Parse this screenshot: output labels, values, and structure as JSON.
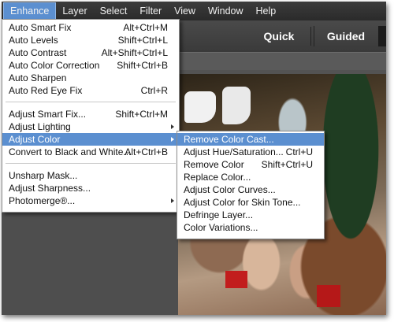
{
  "menubar": {
    "items": [
      "Enhance",
      "Layer",
      "Select",
      "Filter",
      "View",
      "Window",
      "Help"
    ]
  },
  "modes": {
    "quick": "Quick",
    "guided": "Guided"
  },
  "enhance_menu": {
    "items": [
      {
        "label": "Auto Smart Fix",
        "shortcut": "Alt+Ctrl+M"
      },
      {
        "label": "Auto Levels",
        "shortcut": "Shift+Ctrl+L"
      },
      {
        "label": "Auto Contrast",
        "shortcut": "Alt+Shift+Ctrl+L"
      },
      {
        "label": "Auto Color Correction",
        "shortcut": "Shift+Ctrl+B"
      },
      {
        "label": "Auto Sharpen",
        "shortcut": ""
      },
      {
        "label": "Auto Red Eye Fix",
        "shortcut": "Ctrl+R"
      },
      {
        "label": "Adjust Smart Fix...",
        "shortcut": "Shift+Ctrl+M"
      },
      {
        "label": "Adjust Lighting",
        "shortcut": ""
      },
      {
        "label": "Adjust Color",
        "shortcut": ""
      },
      {
        "label": "Convert to Black and White...",
        "shortcut": "Alt+Ctrl+B"
      },
      {
        "label": "Unsharp Mask...",
        "shortcut": ""
      },
      {
        "label": "Adjust Sharpness...",
        "shortcut": ""
      },
      {
        "label": "Photomerge®...",
        "shortcut": ""
      }
    ]
  },
  "adjust_color_submenu": {
    "items": [
      {
        "label": "Remove Color Cast...",
        "shortcut": ""
      },
      {
        "label": "Adjust Hue/Saturation...",
        "shortcut": "Ctrl+U"
      },
      {
        "label": "Remove Color",
        "shortcut": "Shift+Ctrl+U"
      },
      {
        "label": "Replace Color...",
        "shortcut": ""
      },
      {
        "label": "Adjust Color Curves...",
        "shortcut": ""
      },
      {
        "label": "Adjust Color for Skin Tone...",
        "shortcut": ""
      },
      {
        "label": "Defringe Layer...",
        "shortcut": ""
      },
      {
        "label": "Color Variations...",
        "shortcut": ""
      }
    ]
  },
  "colors": {
    "highlight": "#5b8fd0",
    "menubar": "#2f2f2f",
    "workspace": "#535353"
  }
}
